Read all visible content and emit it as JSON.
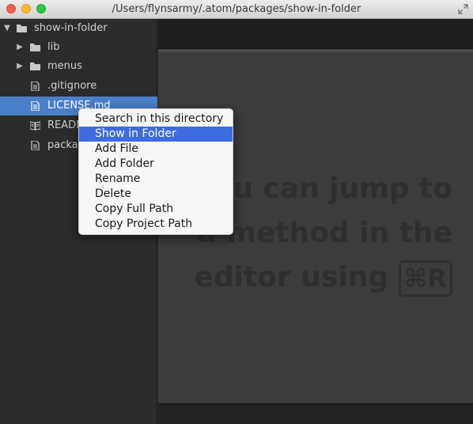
{
  "window": {
    "title": "/Users/flynsarmy/.atom/packages/show-in-folder"
  },
  "tree": {
    "root": {
      "label": "show-in-folder"
    },
    "items": [
      {
        "label": "lib",
        "kind": "folder"
      },
      {
        "label": "menus",
        "kind": "folder"
      },
      {
        "label": ".gitignore",
        "kind": "file"
      },
      {
        "label": "LICENSE.md",
        "kind": "file"
      },
      {
        "label": "READM",
        "kind": "book"
      },
      {
        "label": "packag",
        "kind": "file"
      }
    ]
  },
  "editor": {
    "hint_lines": [
      "u can jump to",
      "a method in the",
      "editor using"
    ],
    "shortcut": "⌘R"
  },
  "context_menu": {
    "items": [
      {
        "label": "Search in this directory"
      },
      {
        "label": "Show in Folder"
      },
      {
        "label": "Add File"
      },
      {
        "label": "Add Folder"
      },
      {
        "label": "Rename"
      },
      {
        "label": "Delete"
      },
      {
        "label": "Copy Full Path"
      },
      {
        "label": "Copy Project Path"
      }
    ],
    "highlighted_color": "#3d6be0"
  },
  "colors": {
    "selection": "#4a7fc9",
    "sidebar_bg": "#2c2c2c",
    "editor_bg": "#3c3c3c"
  }
}
